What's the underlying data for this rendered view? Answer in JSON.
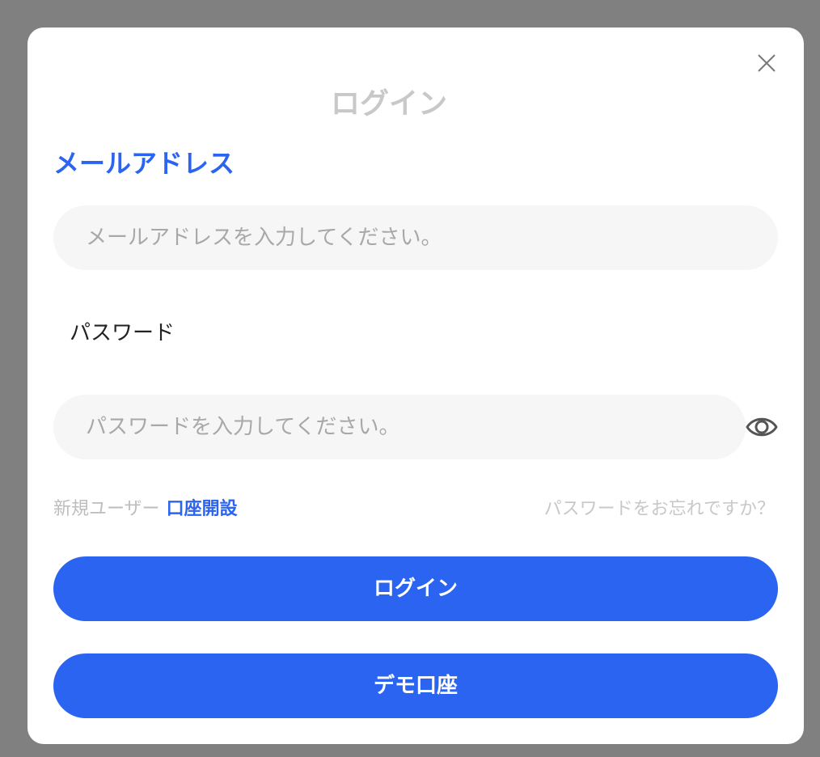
{
  "modal": {
    "title": "ログイン",
    "close_icon": "close-icon"
  },
  "tabs": {
    "email_label": "メールアドレス",
    "password_label": "パスワード"
  },
  "email_field": {
    "placeholder": "メールアドレスを入力してください。",
    "value": ""
  },
  "password_field": {
    "placeholder": "パスワードを入力してください。",
    "value": "",
    "toggle_icon": "eye-icon"
  },
  "links": {
    "new_user_text": "新規ユーザー",
    "open_account_label": "口座開設",
    "forgot_password_label": "パスワードをお忘れですか？"
  },
  "buttons": {
    "login_label": "ログイン",
    "demo_label": "デモ口座"
  },
  "colors": {
    "accent": "#2b64f0",
    "overlay": "#808080",
    "field_bg": "#f6f6f6",
    "muted_text": "#c8c8c8"
  }
}
